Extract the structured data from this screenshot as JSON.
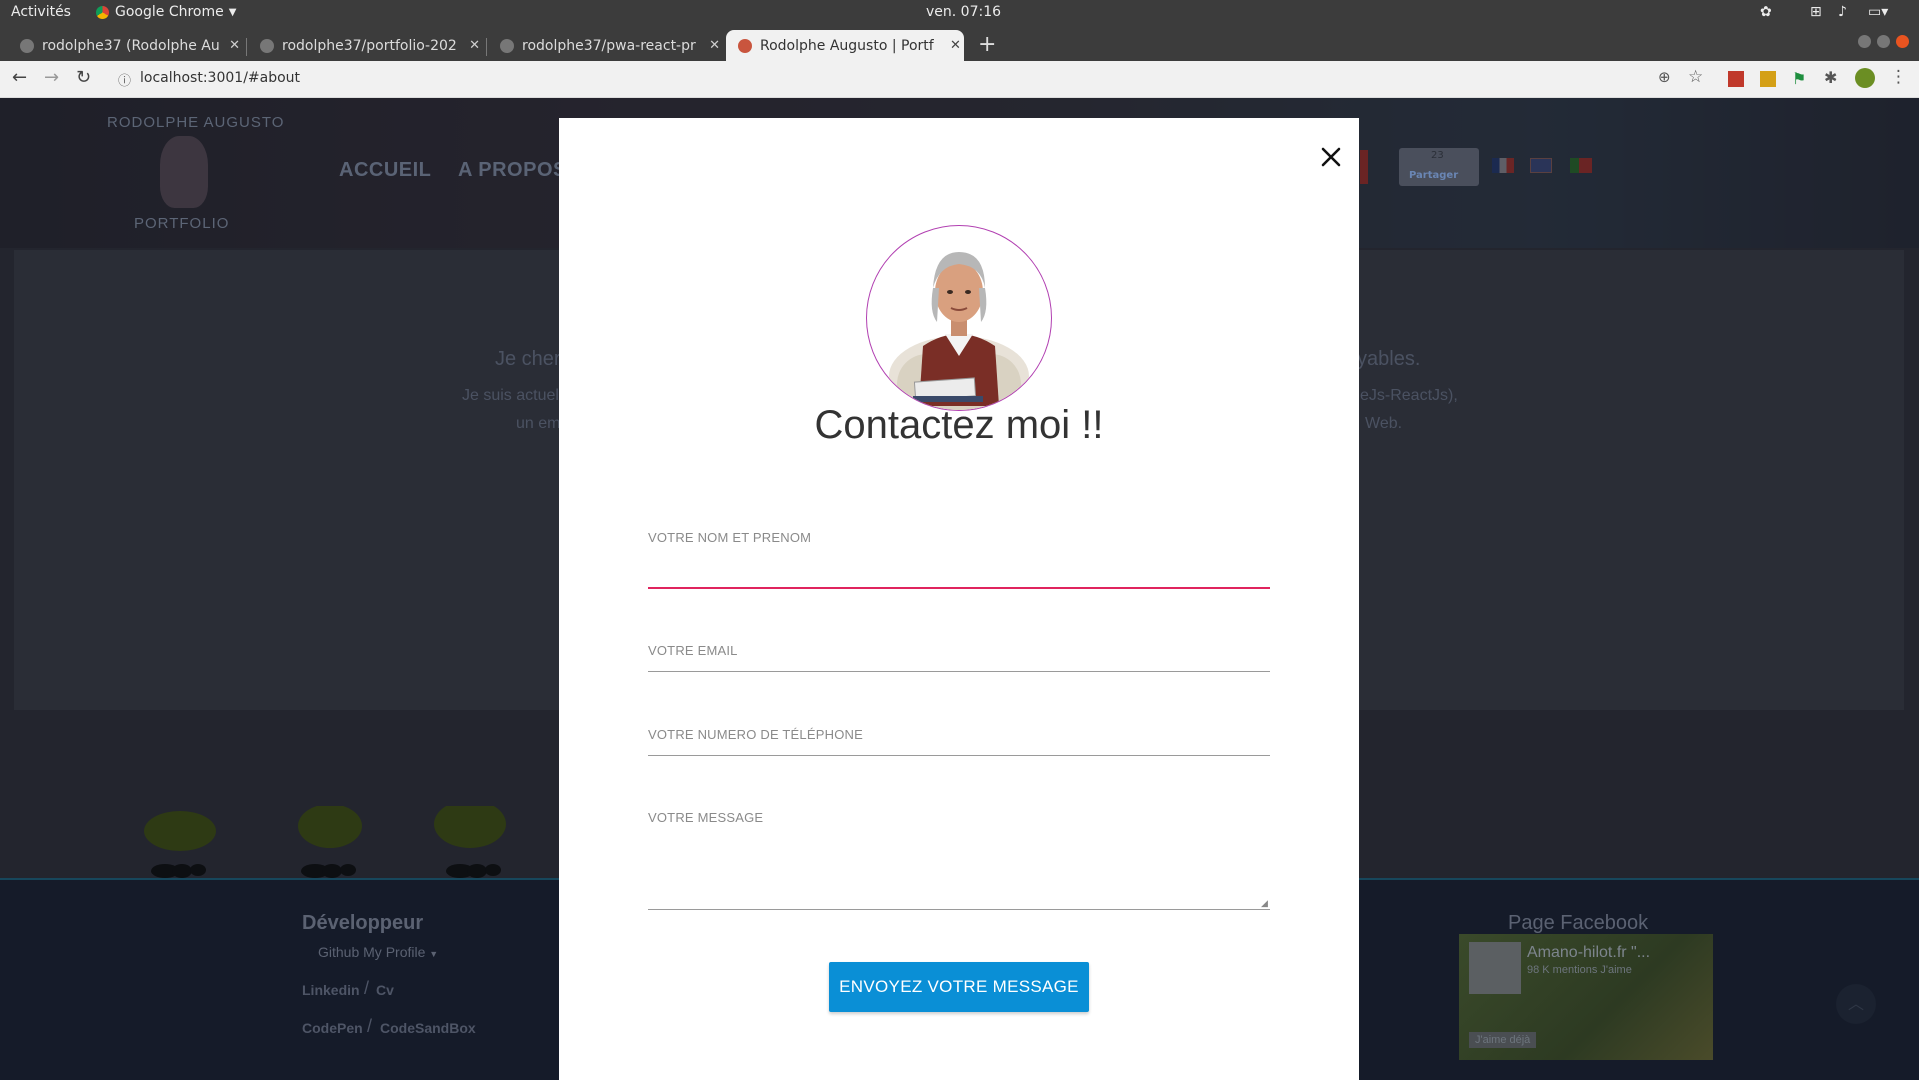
{
  "system_bar": {
    "activities": "Activités",
    "app_name": "Google Chrome",
    "clock": "ven. 07:16"
  },
  "tabs": [
    {
      "title": "rodolphe37 (Rodolphe Au",
      "active": false
    },
    {
      "title": "rodolphe37/portfolio-202",
      "active": false
    },
    {
      "title": "rodolphe37/pwa-react-pr",
      "active": false
    },
    {
      "title": "Rodolphe Augusto | Portf",
      "active": true
    }
  ],
  "address_bar": {
    "url": "localhost:3001/#about"
  },
  "site": {
    "brand_top": "RODOLPHE AUGUSTO",
    "brand_bottom": "PORTFOLIO",
    "nav": [
      "ACCUEIL",
      "A PROPOS"
    ],
    "share_count": "23",
    "share_label": "Partager",
    "about_heading_left": "Je cher",
    "about_heading_right": "yables.",
    "about_line1_left": "Je suis actuel",
    "about_line1_right": "eJs-ReactJs),",
    "about_line2_left": "un em",
    "about_line2_right": "Web.",
    "footer_dev_title": "Développeur",
    "footer_github": "Github My Profile",
    "footer_linkedin": "Linkedin",
    "footer_cv": "Cv",
    "footer_codepen": "CodePen",
    "footer_codesandbox": "CodeSandBox",
    "fb_title": "Page Facebook",
    "fb_page_name": "Amano-hilot.fr \"...",
    "fb_likes": "98 K mentions J'aime",
    "fb_like_button": "J'aime déjà",
    "slash": "/"
  },
  "modal": {
    "title": "Contactez moi !!",
    "fields": {
      "name_label": "VOTRE NOM ET PRENOM",
      "name_value": "",
      "email_label": "VOTRE EMAIL",
      "email_value": "",
      "phone_label": "VOTRE NUMERO DE TÉLÉPHONE",
      "phone_value": "",
      "message_label": "VOTRE MESSAGE",
      "message_value": ""
    },
    "submit_label": "ENVOYEZ VOTRE MESSAGE",
    "colors": {
      "accent_underline": "#e0245e",
      "button": "#0a8fd6",
      "avatar_ring": "#b13fb1"
    }
  }
}
